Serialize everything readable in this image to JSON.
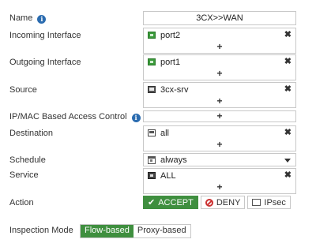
{
  "labels": {
    "name": "Name",
    "incoming": "Incoming Interface",
    "outgoing": "Outgoing Interface",
    "source": "Source",
    "ipmac": "IP/MAC Based Access Control",
    "destination": "Destination",
    "schedule": "Schedule",
    "service": "Service",
    "action": "Action",
    "inspection": "Inspection Mode"
  },
  "fields": {
    "name_value": "3CX>>WAN",
    "incoming": "port2",
    "outgoing": "port1",
    "source": "3cx-srv",
    "destination": "all",
    "schedule": "always",
    "service": "ALL"
  },
  "glyphs": {
    "remove": "✖",
    "add": "+",
    "info": "i",
    "check": "✔"
  },
  "actions": {
    "accept": "ACCEPT",
    "deny": "DENY",
    "ipsec": "IPsec",
    "selected": "accept"
  },
  "inspection_mode": {
    "flow": "Flow-based",
    "proxy": "Proxy-based",
    "selected": "flow"
  },
  "colors": {
    "accent_green": "#3f8f3f",
    "info_blue": "#2b6cb0",
    "deny_red": "#cc3333"
  },
  "icons": {
    "name_info": "info-icon",
    "ipmac_info": "info-icon",
    "incoming": "interface-port-icon",
    "outgoing": "interface-port-icon",
    "source": "address-host-icon",
    "destination": "address-icon",
    "schedule": "calendar-icon",
    "service": "service-icon"
  }
}
